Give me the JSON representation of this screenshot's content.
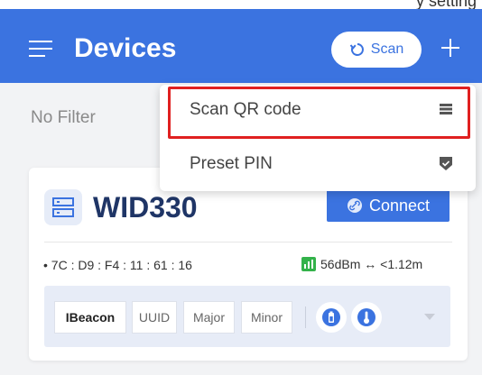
{
  "top_strip": {
    "text": "y setting"
  },
  "header": {
    "title": "Devices",
    "scan_label": "Scan"
  },
  "filter": {
    "label": "No Filter"
  },
  "dropdown": {
    "items": [
      {
        "label": "Scan QR code",
        "icon": "list-icon"
      },
      {
        "label": "Preset PIN",
        "icon": "shield-check-icon"
      }
    ]
  },
  "device": {
    "name": "WID330",
    "connect_label": "Connect",
    "mac": "7C : D9 : F4 : 11 : 61 : 16",
    "signal": "56dBm ↔ <1.12m",
    "tags": [
      "IBeacon",
      "UUID",
      "Major",
      "Minor"
    ],
    "icons": [
      "battery-icon",
      "temperature-icon"
    ]
  },
  "colors": {
    "accent": "#3b73e0",
    "highlight": "#e02020",
    "signal": "#33b24a"
  }
}
